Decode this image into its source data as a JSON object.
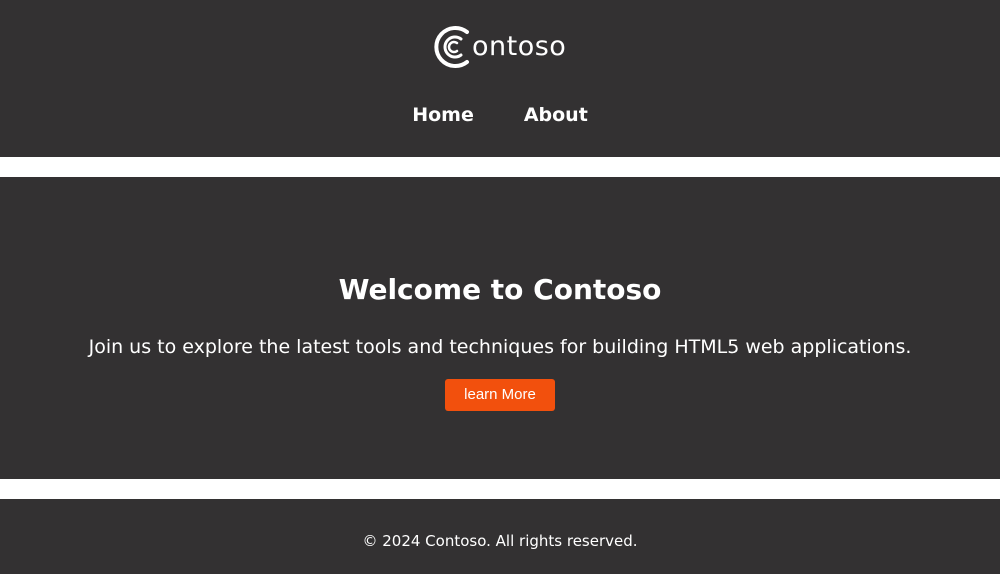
{
  "header": {
    "logo_text": "ontoso",
    "nav": {
      "home_label": "Home",
      "about_label": "About"
    }
  },
  "hero": {
    "title": "Welcome to Contoso",
    "text": "Join us to explore the latest tools and techniques for building HTML5 web applications.",
    "button_label": "learn More"
  },
  "footer": {
    "copyright": "© 2024 Contoso. All rights reserved."
  },
  "colors": {
    "panel_background": "#333132",
    "page_background": "#ffffff",
    "accent_button": "#f2500d",
    "text": "#ffffff"
  },
  "icons": {
    "logo_mark": "contoso-c-logo-icon"
  }
}
